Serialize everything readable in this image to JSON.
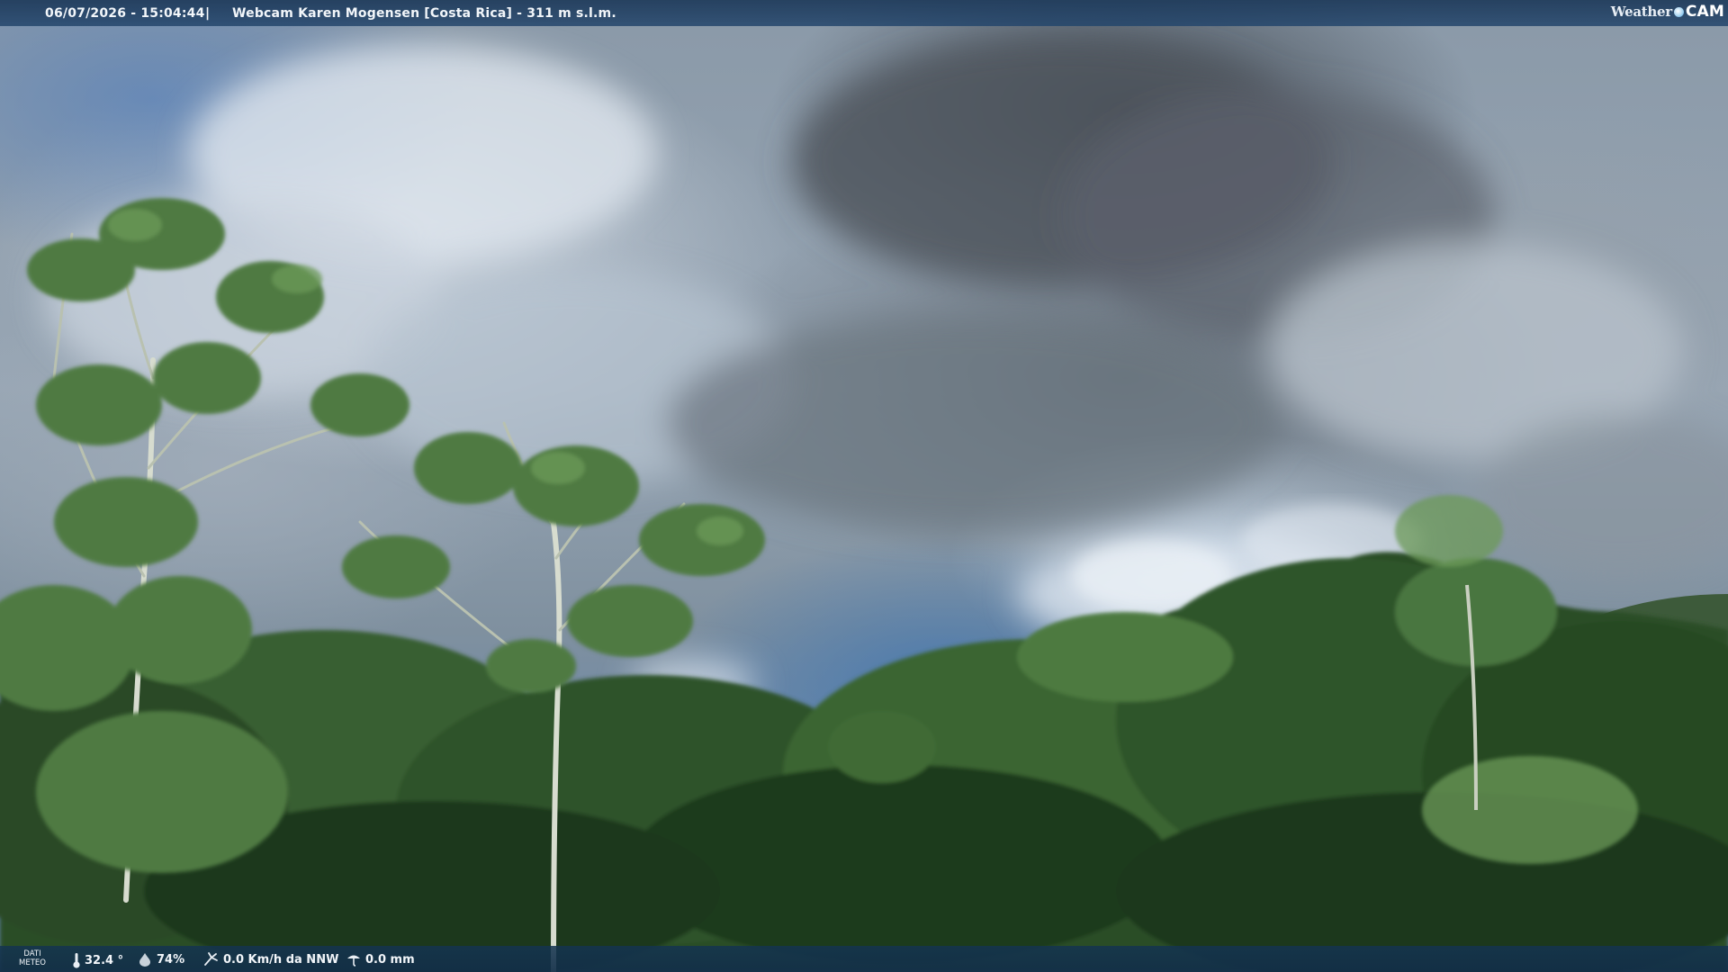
{
  "overlay_top": {
    "datetime": "06/07/2026 - 15:04:44",
    "separator": "|",
    "title": "Webcam Karen Mogensen [Costa Rica] - 311 m s.l.m."
  },
  "logo": {
    "word": "Weather",
    "cam": "CAM"
  },
  "overlay_bottom": {
    "meteo_label_line1": "DATI",
    "meteo_label_line2": "METEO",
    "temperature": "32.4 °",
    "humidity": "74%",
    "wind": "0.0 Km/h da NNW",
    "rain": "0.0 mm"
  },
  "icons": [
    "thermometer-icon",
    "humidity-drop-icon",
    "wind-icon",
    "rain-gauge-icon"
  ],
  "colors": {
    "bar_top": "#1e3a5a",
    "bar_bottom": "#143450",
    "foliage_dark": "#1d3a1c",
    "foliage_mid": "#355e2e",
    "foliage_light": "#5e8e4a"
  }
}
